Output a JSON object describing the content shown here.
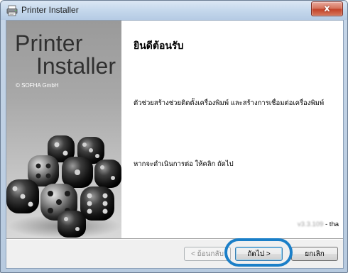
{
  "window": {
    "title": "Printer Installer",
    "close_label": "x",
    "icon": "printer-installer-icon"
  },
  "sidebar": {
    "brand_line1": "Printer",
    "brand_line2": "Installer",
    "copyright": "© SOFHA GmbH",
    "artwork": "glass-dice-artwork"
  },
  "content": {
    "heading": "ยินดีต้อนรับ",
    "description": "ตัวช่วยสร้างช่วยติดตั้งเครื่องพิมพ์ และสร้างการเชื่อมต่อเครื่องพิมพ์",
    "instruction": "หากจะดำเนินการต่อ ให้คลิก ถัดไป",
    "version": "v3.3.109",
    "language": " - tha"
  },
  "buttons": {
    "back": "< ย้อนกลับ",
    "next": "ถัดไป >",
    "cancel": "ยกเลิก"
  },
  "colors": {
    "highlight_ring": "#1b7fc8",
    "close_button": "#c3432a",
    "titlebar": "#c5d8ec"
  }
}
